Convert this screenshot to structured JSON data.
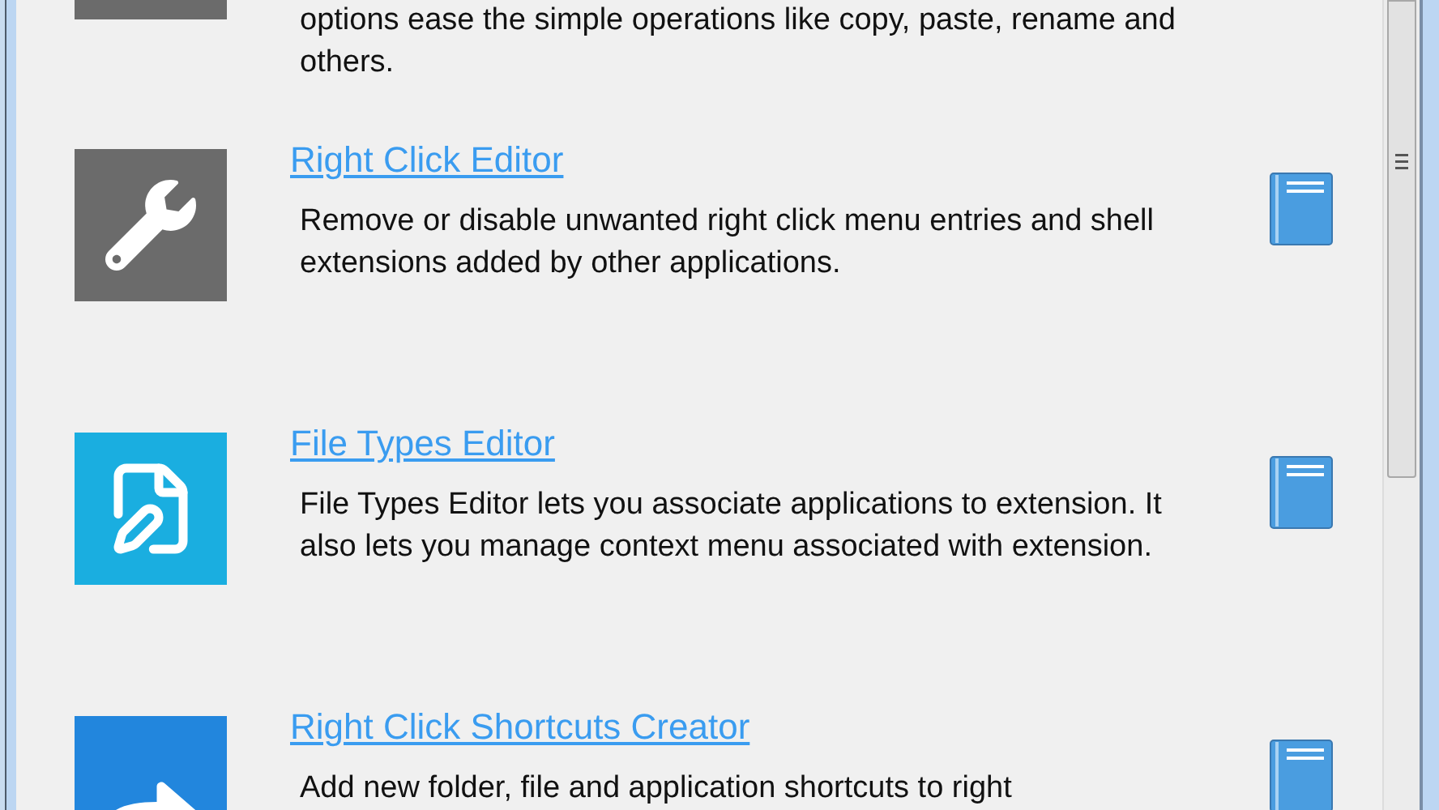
{
  "items": [
    {
      "kind": "blank",
      "color": "#6b6b6b",
      "description": "options ease the simple  operations like copy, paste, rename and others."
    },
    {
      "kind": "wrench",
      "color": "#6b6b6b",
      "title": "Right Click Editor",
      "description": "Remove or disable unwanted right click menu entries and shell extensions added by other applications."
    },
    {
      "kind": "file-edit",
      "color": "#1aaee0",
      "title": "File Types Editor",
      "description": "File Types Editor lets you associate applications to extension. It also lets you manage context menu associated with extension."
    },
    {
      "kind": "share",
      "color": "#2286dd",
      "title": "Right Click Shortcuts Creator",
      "description": "Add new folder, file  and application shortcuts to right"
    }
  ]
}
